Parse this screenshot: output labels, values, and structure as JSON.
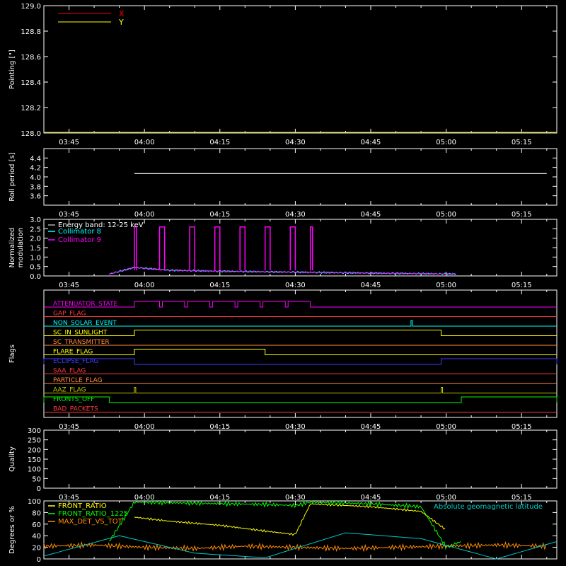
{
  "chart_data": [
    {
      "type": "line",
      "ylabel": "Pointing [\"]",
      "ylim": [
        128.0,
        129.0
      ],
      "ytick_labels": [
        "128.0",
        "128.2",
        "128.4",
        "128.6",
        "128.8",
        "129.0"
      ],
      "x_tick_labels": [
        "03:45",
        "04:00",
        "04:15",
        "04:30",
        "04:45",
        "05:00",
        "05:15"
      ],
      "legend": "top-left",
      "series": [
        {
          "name": "X",
          "color": "#ff0000",
          "values": []
        },
        {
          "name": "Y",
          "color": "#ffff00",
          "values": []
        }
      ]
    },
    {
      "type": "line",
      "ylabel": "Roll period [s]",
      "ylim": [
        3.4,
        4.6
      ],
      "ytick_labels": [
        "3.6",
        "3.8",
        "4.0",
        "4.2",
        "4.4"
      ],
      "x_tick_labels": [
        "03:45",
        "04:00",
        "04:15",
        "04:30",
        "04:45",
        "05:00",
        "05:15"
      ],
      "series": [
        {
          "color": "#ffffff",
          "x": [
            "03:58",
            "05:20"
          ],
          "values": [
            4.07,
            4.07
          ]
        }
      ]
    },
    {
      "type": "line",
      "ylabel": "Normalized modulation",
      "ylim": [
        0.0,
        3.0
      ],
      "ytick_labels": [
        "0.0",
        "0.5",
        "1.0",
        "1.5",
        "2.0",
        "2.5",
        "3.0"
      ],
      "x_tick_labels": [
        "03:45",
        "04:00",
        "04:15",
        "04:30",
        "04:45",
        "05:00",
        "05:15"
      ],
      "legend": "top-left",
      "legend_title": "Energy band: 12-25 keV",
      "series": [
        {
          "name": "Collimator 8",
          "color": "#00ffff",
          "x": [
            "03:53",
            "03:58",
            "04:05",
            "04:15",
            "04:30",
            "04:45",
            "05:02"
          ],
          "values": [
            0.1,
            0.45,
            0.3,
            0.25,
            0.2,
            0.15,
            0.1
          ]
        },
        {
          "name": "Collimator 9",
          "color": "#ff00ff",
          "x": [
            "03:53",
            "03:58",
            "04:05",
            "04:15",
            "04:30",
            "04:45",
            "05:02"
          ],
          "values": [
            0.1,
            0.45,
            0.3,
            0.25,
            0.2,
            0.15,
            0.1
          ]
        }
      ],
      "spikes": [
        {
          "start": "03:58",
          "end": "03:58",
          "value": 2.6
        },
        {
          "start": "04:03",
          "end": "04:04",
          "value": 2.6
        },
        {
          "start": "04:09",
          "end": "04:10",
          "value": 2.6
        },
        {
          "start": "04:14",
          "end": "04:15",
          "value": 2.6
        },
        {
          "start": "04:19",
          "end": "04:20",
          "value": 2.6
        },
        {
          "start": "04:24",
          "end": "04:25",
          "value": 2.6
        },
        {
          "start": "04:29",
          "end": "04:30",
          "value": 2.6
        },
        {
          "start": "04:33",
          "end": "04:33",
          "value": 2.6
        }
      ]
    },
    {
      "type": "line",
      "ylabel": "Flags",
      "x_tick_labels": [
        "03:45",
        "04:00",
        "04:15",
        "04:30",
        "04:45",
        "05:00",
        "05:15"
      ],
      "flags": [
        {
          "name": "ATTENUATOR_STATE",
          "color": "#ff00ff",
          "high": [
            [
              "03:58",
              "04:33"
            ]
          ],
          "dips": [
            "04:03",
            "04:08",
            "04:13",
            "04:18",
            "04:23",
            "04:28"
          ]
        },
        {
          "name": "GAP_FLAG",
          "color": "#ff3c3c",
          "high": []
        },
        {
          "name": "NON_SOLAR_EVENT",
          "color": "#00ffff",
          "high": [
            [
              "04:53",
              "04:53"
            ]
          ]
        },
        {
          "name": "SC_IN_SUNLIGHT",
          "color": "#ffff00",
          "high": [
            [
              "03:58",
              "04:59"
            ]
          ]
        },
        {
          "name": "SC_TRANSMITTER",
          "color": "#ff8c3c",
          "high": []
        },
        {
          "name": "FLARE_FLAG",
          "color": "#ffff00",
          "high": [
            [
              "03:58",
              "04:24"
            ]
          ]
        },
        {
          "name": "ECLIPSE_FLAG",
          "color": "#3c3cff",
          "high": [
            [
              "03:40",
              "03:58"
            ],
            [
              "04:59",
              "05:22"
            ]
          ]
        },
        {
          "name": "SAA_FLAG",
          "color": "#ff3c3c",
          "high": []
        },
        {
          "name": "PARTICLE_FLAG",
          "color": "#ff8c3c",
          "high": []
        },
        {
          "name": "AAZ_FLAG",
          "color": "#c8c800",
          "high": [
            [
              "03:58",
              "03:58"
            ],
            [
              "04:59",
              "04:59"
            ]
          ]
        },
        {
          "name": "FRONTS_OFF",
          "color": "#00ff00",
          "high": [
            [
              "03:40",
              "03:53"
            ],
            [
              "05:03",
              "05:22"
            ]
          ]
        },
        {
          "name": "BAD_PACKETS",
          "color": "#ff3c3c",
          "high": []
        }
      ]
    },
    {
      "type": "line",
      "ylabel": "Quality",
      "ylim": [
        0,
        300
      ],
      "ytick_labels": [
        "0",
        "50",
        "100",
        "150",
        "200",
        "250",
        "300"
      ],
      "x_tick_labels": [
        "03:45",
        "04:00",
        "04:15",
        "04:30",
        "04:45",
        "05:00",
        "05:15"
      ],
      "series": []
    },
    {
      "type": "line",
      "ylabel": "Degrees or %",
      "ylim": [
        0,
        100
      ],
      "ytick_labels": [
        "0",
        "20",
        "40",
        "60",
        "80",
        "100"
      ],
      "legend": "top-left",
      "annotation": "Absolute geomagnetic latitude",
      "series": [
        {
          "name": "FRONT_RATIO",
          "color": "#ffff00",
          "x": [
            "03:58",
            "04:05",
            "04:15",
            "04:24",
            "04:30",
            "04:33",
            "04:45",
            "04:55",
            "05:00"
          ],
          "values": [
            72,
            65,
            58,
            48,
            42,
            95,
            90,
            82,
            50
          ]
        },
        {
          "name": "FRONT_RATIO_1225",
          "color": "#00ff00",
          "x": [
            "03:53",
            "03:58",
            "04:10",
            "04:24",
            "04:30",
            "04:33",
            "04:45",
            "04:55",
            "05:00",
            "05:03"
          ],
          "values": [
            30,
            98,
            96,
            94,
            92,
            98,
            95,
            90,
            20,
            30
          ]
        },
        {
          "name": "MAX_DET_VS_TOT",
          "color": "#ff8c00",
          "x": [
            "03:40",
            "03:50",
            "04:00",
            "04:10",
            "04:20",
            "04:30",
            "04:40",
            "04:50",
            "05:00",
            "05:10",
            "05:20"
          ],
          "values": [
            22,
            24,
            20,
            18,
            22,
            20,
            18,
            20,
            22,
            24,
            22
          ]
        },
        {
          "name": "Absolute geomagnetic latitude",
          "color": "#00c8c8",
          "x": [
            "03:40",
            "03:55",
            "04:10",
            "04:24",
            "04:40",
            "04:55",
            "05:10",
            "05:22"
          ],
          "values": [
            5,
            40,
            10,
            2,
            45,
            35,
            0,
            30
          ]
        }
      ]
    }
  ]
}
